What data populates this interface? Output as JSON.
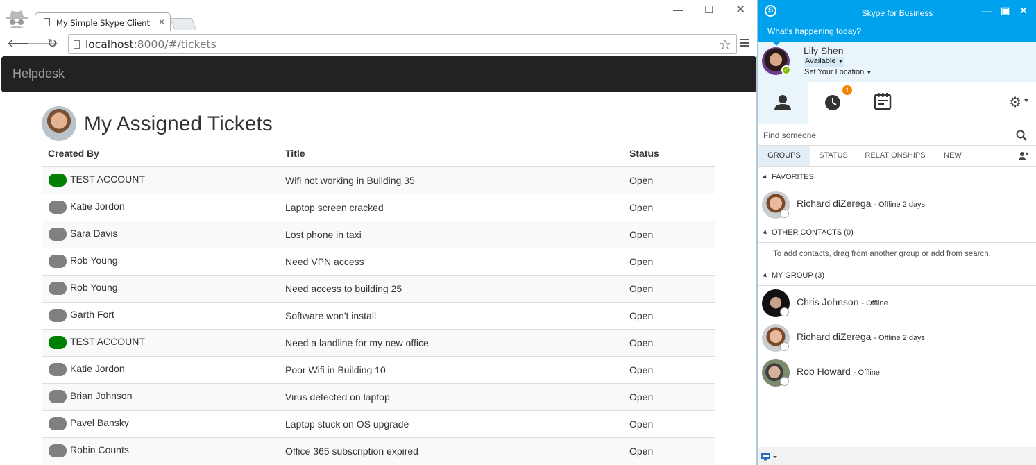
{
  "browser": {
    "tab_title": "My Simple Skype Client",
    "url_host": "localhost",
    "url_path": ":8000/#/tickets"
  },
  "app": {
    "brand": "Helpdesk",
    "page_title": "My Assigned Tickets"
  },
  "tickets": {
    "columns": [
      "Created By",
      "Title",
      "Status"
    ],
    "rows": [
      {
        "created_by": "TEST ACCOUNT",
        "presence": "green",
        "title": "Wifi not working in Building 35",
        "status": "Open"
      },
      {
        "created_by": "Katie Jordon",
        "presence": "gray",
        "title": "Laptop screen cracked",
        "status": "Open"
      },
      {
        "created_by": "Sara Davis",
        "presence": "gray",
        "title": "Lost phone in taxi",
        "status": "Open"
      },
      {
        "created_by": "Rob Young",
        "presence": "gray",
        "title": "Need VPN access",
        "status": "Open"
      },
      {
        "created_by": "Rob Young",
        "presence": "gray",
        "title": "Need access to building 25",
        "status": "Open"
      },
      {
        "created_by": "Garth Fort",
        "presence": "gray",
        "title": "Software won't install",
        "status": "Open"
      },
      {
        "created_by": "TEST ACCOUNT",
        "presence": "green",
        "title": "Need a landline for my new office",
        "status": "Open"
      },
      {
        "created_by": "Katie Jordon",
        "presence": "gray",
        "title": "Poor Wifi in Building 10",
        "status": "Open"
      },
      {
        "created_by": "Brian Johnson",
        "presence": "gray",
        "title": "Virus detected on laptop",
        "status": "Open"
      },
      {
        "created_by": "Pavel Bansky",
        "presence": "gray",
        "title": "Laptop stuck on OS upgrade",
        "status": "Open"
      },
      {
        "created_by": "Robin Counts",
        "presence": "gray",
        "title": "Office 365 subscription expired",
        "status": "Open"
      }
    ]
  },
  "skype": {
    "window_title": "Skype for Business",
    "whats_happening": "What's happening today?",
    "me": {
      "name": "Lily Shen",
      "availability": "Available",
      "location": "Set Your Location"
    },
    "history_badge": "1",
    "search_placeholder": "Find someone",
    "subtabs": [
      "GROUPS",
      "STATUS",
      "RELATIONSHIPS",
      "NEW"
    ],
    "groups": {
      "favorites": "FAVORITES",
      "other_contacts": "OTHER CONTACTS (0)",
      "other_hint": "To add contacts, drag from another group or add from search.",
      "my_group": "MY GROUP (3)"
    },
    "favorites": [
      {
        "name": "Richard diZerega",
        "status": "- Offline 2 days"
      }
    ],
    "my_group": [
      {
        "name": "Chris Johnson",
        "status": "- Offline"
      },
      {
        "name": "Richard diZerega",
        "status": "- Offline 2 days"
      },
      {
        "name": "Rob Howard",
        "status": "- Offline"
      }
    ]
  },
  "colors": {
    "navbar": "#222222",
    "skype_blue": "#00a2ed",
    "presence_green": "#008000",
    "presence_gray": "#808080",
    "badge_orange": "#f58300"
  }
}
